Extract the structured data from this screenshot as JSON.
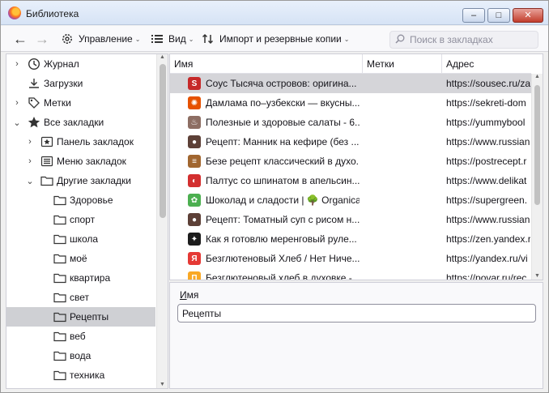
{
  "window": {
    "title": "Библиотека"
  },
  "toolbar": {
    "manage_label": "Управление",
    "view_label": "Вид",
    "import_label": "Импорт и резервные копии",
    "search_placeholder": "Поиск в закладках"
  },
  "sidebar": {
    "items": [
      {
        "label": "Журнал",
        "icon": "clock-icon",
        "twisty": ">"
      },
      {
        "label": "Загрузки",
        "icon": "download-icon",
        "twisty": ""
      },
      {
        "label": "Метки",
        "icon": "tag-icon",
        "twisty": ">"
      },
      {
        "label": "Все закладки",
        "icon": "star-icon",
        "twisty": "v"
      },
      {
        "label": "Панель закладок",
        "icon": "bookmarks-toolbar-icon",
        "twisty": ">"
      },
      {
        "label": "Меню закладок",
        "icon": "bookmarks-menu-icon",
        "twisty": ">"
      },
      {
        "label": "Другие закладки",
        "icon": "folder-icon",
        "twisty": "v"
      },
      {
        "label": "Здоровье",
        "icon": "folder-icon",
        "twisty": ""
      },
      {
        "label": "спорт",
        "icon": "folder-icon",
        "twisty": ""
      },
      {
        "label": "школа",
        "icon": "folder-icon",
        "twisty": ""
      },
      {
        "label": "моё",
        "icon": "folder-icon",
        "twisty": ""
      },
      {
        "label": "квартира",
        "icon": "folder-icon",
        "twisty": ""
      },
      {
        "label": "свет",
        "icon": "folder-icon",
        "twisty": ""
      },
      {
        "label": "Рецепты",
        "icon": "folder-icon",
        "twisty": ""
      },
      {
        "label": "веб",
        "icon": "folder-icon",
        "twisty": ""
      },
      {
        "label": "вода",
        "icon": "folder-icon",
        "twisty": ""
      },
      {
        "label": "техника",
        "icon": "folder-icon",
        "twisty": ""
      }
    ]
  },
  "list": {
    "columns": {
      "name": "Имя",
      "tags": "Метки",
      "address": "Адрес"
    },
    "rows": [
      {
        "name": "Соус Тысяча островов: оригина...",
        "address": "https://sousec.ru/za",
        "favicon": "sousec-favicon",
        "color": "#c62828",
        "glyph": "S"
      },
      {
        "name": "Дамлама по–узбекски — вкусны...",
        "address": "https://sekreti-dom",
        "favicon": "sekreti-favicon",
        "color": "#e65100",
        "glyph": "✺"
      },
      {
        "name": "Полезные и здоровые салаты - 6...",
        "address": "https://yummybool",
        "favicon": "yummybook-favicon",
        "color": "#8d6e63",
        "glyph": "♨"
      },
      {
        "name": "Рецепт: Манник на кефире (без ...",
        "address": "https://www.russian",
        "favicon": "russianfood-favicon",
        "color": "#5d4037",
        "glyph": "●"
      },
      {
        "name": "Безе рецепт классический в духо...",
        "address": "https://postrecept.r",
        "favicon": "postrecept-favicon",
        "color": "#a1662f",
        "glyph": "≡"
      },
      {
        "name": "Палтус со шпинатом в апельсин...",
        "address": "https://www.delikat",
        "favicon": "delikatesy-favicon",
        "color": "#d32f2f",
        "glyph": "◐"
      },
      {
        "name": "Шоколад и сладости | 🌳 Organica",
        "address": "https://supergreen.",
        "favicon": "supergreen-favicon",
        "color": "#4caf50",
        "glyph": "✿"
      },
      {
        "name": "Рецепт: Томатный суп с рисом н...",
        "address": "https://www.russian",
        "favicon": "russianfood-favicon",
        "color": "#5d4037",
        "glyph": "●"
      },
      {
        "name": "Как я готовлю меренговый руле...",
        "address": "https://zen.yandex.r",
        "favicon": "zen-favicon",
        "color": "#1c1c1c",
        "glyph": "✦"
      },
      {
        "name": "Безглютеновый Хлеб / Нет Ниче...",
        "address": "https://yandex.ru/vi",
        "favicon": "yandex-favicon",
        "color": "#e53935",
        "glyph": "Я"
      },
      {
        "name": "Безглютеновый хлеб в духовке - ...",
        "address": "https://povar.ru/rec",
        "favicon": "povar-favicon",
        "color": "#f9a825",
        "glyph": "П"
      }
    ]
  },
  "details": {
    "name_label_accel": "И",
    "name_label_rest": "мя",
    "name_value": "Рецепты"
  }
}
